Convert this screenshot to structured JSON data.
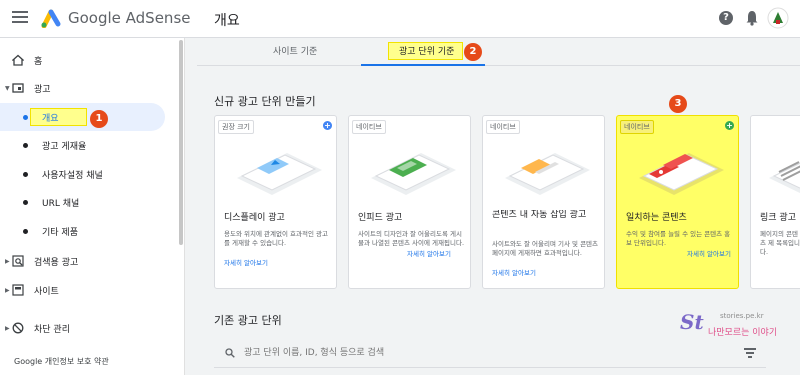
{
  "header": {
    "brand": "Google AdSense",
    "page_title": "개요",
    "help_label": "?"
  },
  "sidebar": {
    "items": [
      {
        "label": "홈",
        "icon": "home-icon"
      },
      {
        "label": "광고",
        "icon": "ad-icon"
      },
      {
        "label": "개요"
      },
      {
        "label": "광고 게재율"
      },
      {
        "label": "사용자설정 채널"
      },
      {
        "label": "URL 채널"
      },
      {
        "label": "기타 제품"
      },
      {
        "label": "검색용 광고",
        "icon": "search-ads-icon"
      },
      {
        "label": "사이트",
        "icon": "site-icon"
      },
      {
        "label": "차단 관리",
        "icon": "block-icon"
      }
    ],
    "footer": "Google  개인정보 보호  약관"
  },
  "tabs": [
    {
      "label": "사이트 기준"
    },
    {
      "label": "광고 단위 기준"
    }
  ],
  "annotations": {
    "badge1": "1",
    "badge2": "2",
    "badge3": "3"
  },
  "sections": {
    "new_title": "신규 광고 단위 만들기",
    "existing_title": "기존 광고 단위"
  },
  "cards": [
    {
      "tag": "권장 크기",
      "title": "디스플레이 광고",
      "desc": "용도와 위치에 관계없이 효과적인 광고를 게재할 수 있습니다.",
      "link": "자세히 알아보기"
    },
    {
      "tag": "네이티브",
      "title": "인피드 광고",
      "desc": "사이트의 디자인과 잘 어울리도록 게시물과 나열된 콘텐츠 사이에 게재됩니다.",
      "link": "자세히 알아보기"
    },
    {
      "tag": "네이티브",
      "title": "콘텐츠 내 자동 삽입 광고",
      "desc": "사이트와도 잘 어울리며 기사 및 콘텐츠 페이지에 게재하면 효과적입니다.",
      "link": "자세히 알아보기"
    },
    {
      "tag": "네이티브",
      "title": "일치하는 콘텐츠",
      "desc": "수익 및 참여를 늘릴 수 있는 콘텐츠 홍보 단위입니다.",
      "link": "자세히 알아보기"
    },
    {
      "tag": "",
      "title": "링크 광고",
      "desc": "페이지의 콘텐츠 제 목록입니다.",
      "link": ""
    }
  ],
  "search": {
    "placeholder": "광고 단위 이름, ID, 형식 등으로 검색"
  },
  "watermark": {
    "logo": "St",
    "url": "stories.pe.kr",
    "sub": "나만모르는 이야기"
  },
  "colors": {
    "accent": "#1a73e8",
    "highlight": "#ffff66",
    "badge": "#e64a19"
  }
}
